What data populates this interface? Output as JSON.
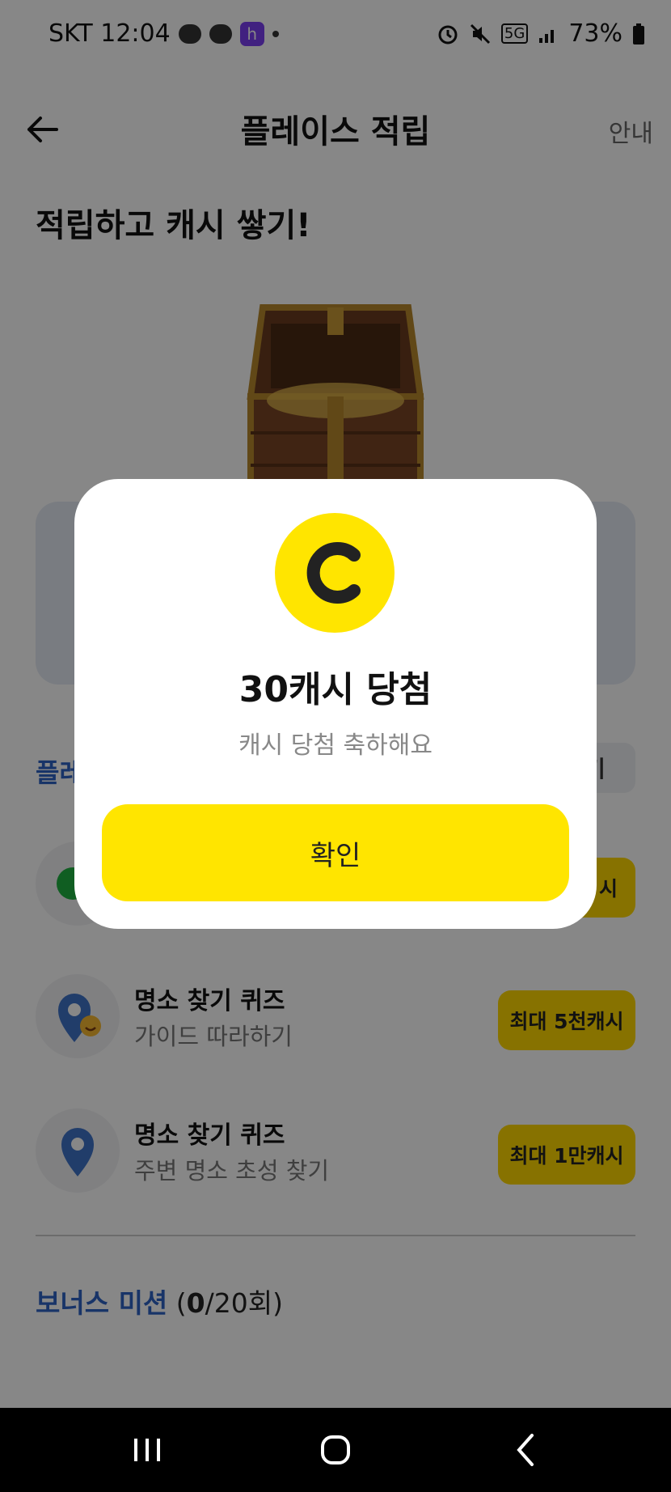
{
  "status_bar": {
    "carrier_time": "SKT 12:04",
    "network": "5G",
    "battery": "73%",
    "notification_badge": "h"
  },
  "header": {
    "title": "플레이스 적립",
    "guide_label": "안내"
  },
  "main": {
    "headline": "적립하고 캐시 쌓기!",
    "section_title": "플레",
    "section_right_label": "기",
    "missions": [
      {
        "title": "명소 찾기 퀴즈",
        "subtitle": "가이드 따라하기",
        "reward": "최대 5천캐시",
        "icon": "map-pin-smile-icon"
      },
      {
        "title": "명소 찾기 퀴즈",
        "subtitle": "주변 명소 초성 찾기",
        "reward": "최대 1만캐시",
        "icon": "map-pin-icon"
      }
    ],
    "partial_reward_label": "시",
    "bonus": {
      "title": "보너스 미션",
      "count_open": "(",
      "count_done": "0",
      "count_rest": "/20회)"
    }
  },
  "modal": {
    "coin_letter": "C",
    "title": "30캐시 당첨",
    "subtitle": "캐시 당첨 축하해요",
    "confirm_label": "확인"
  },
  "colors": {
    "accent_yellow": "#ffe500",
    "link_blue": "#2f63c5",
    "overlay": "rgba(0,0,0,0.47)"
  }
}
